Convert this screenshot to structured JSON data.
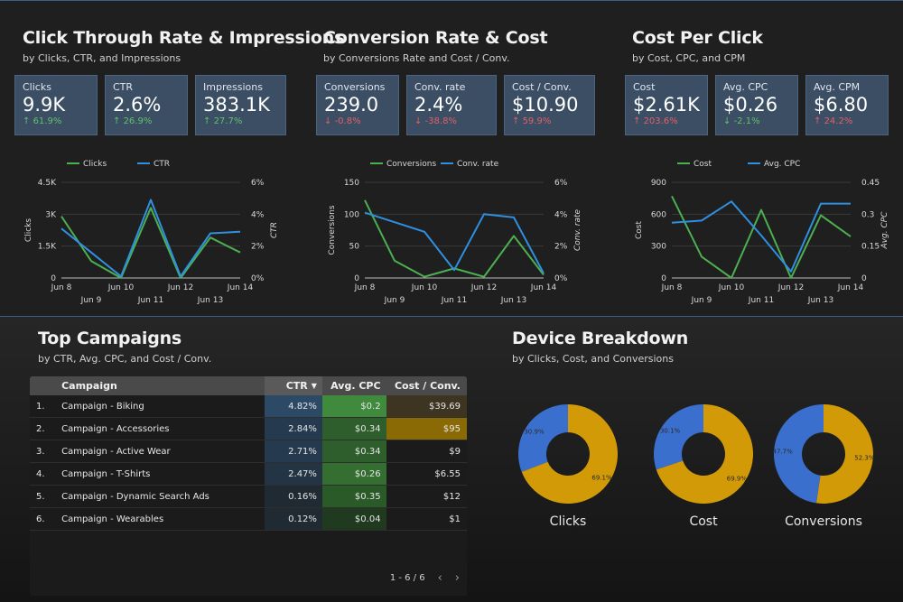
{
  "colors": {
    "green": "#4caf50",
    "blue": "#2f8fe0",
    "kpi_bg": "#3b4e63",
    "donut_blue": "#3b6fce",
    "donut_gold": "#d19a06"
  },
  "sections": [
    {
      "title": "Click Through Rate & Impressions",
      "subtitle": "by Clicks, CTR, and Impressions",
      "kpis": [
        {
          "label": "Clicks",
          "value": "9.9K",
          "delta": "61.9%",
          "dir": "up"
        },
        {
          "label": "CTR",
          "value": "2.6%",
          "delta": "26.9%",
          "dir": "up"
        },
        {
          "label": "Impressions",
          "value": "383.1K",
          "delta": "27.7%",
          "dir": "up"
        }
      ]
    },
    {
      "title": "Conversion Rate & Cost",
      "subtitle": "by Conversions Rate and Cost / Conv.",
      "kpis": [
        {
          "label": "Conversions",
          "value": "239.0",
          "delta": "-0.8%",
          "dir": "down"
        },
        {
          "label": "Conv. rate",
          "value": "2.4%",
          "delta": "-38.8%",
          "dir": "down"
        },
        {
          "label": "Cost / Conv.",
          "value": "$10.90",
          "delta": "59.9%",
          "dir": "up-bad"
        }
      ]
    },
    {
      "title": "Cost Per Click",
      "subtitle": "by Cost, CPC, and CPM",
      "kpis": [
        {
          "label": "Cost",
          "value": "$2.61K",
          "delta": "203.6%",
          "dir": "up-bad"
        },
        {
          "label": "Avg. CPC",
          "value": "$0.26",
          "delta": "-2.1%",
          "dir": "down-good"
        },
        {
          "label": "Avg. CPM",
          "value": "$6.80",
          "delta": "24.2%",
          "dir": "up-bad"
        }
      ]
    }
  ],
  "chart_data": [
    {
      "type": "line",
      "x": [
        "Jun 8",
        "Jun 9",
        "Jun 10",
        "Jun 11",
        "Jun 12",
        "Jun 13",
        "Jun 14"
      ],
      "series": [
        {
          "name": "Clicks",
          "axis": "left",
          "values": [
            2900,
            800,
            0,
            3300,
            0,
            1900,
            1200
          ]
        },
        {
          "name": "CTR",
          "axis": "right",
          "values": [
            3.1,
            1.6,
            0.1,
            4.9,
            0.1,
            2.8,
            2.9
          ]
        }
      ],
      "ylabel": "Clicks",
      "y2label": "CTR",
      "yticks": [
        "0",
        "1.5K",
        "3K",
        "4.5K"
      ],
      "ylim": [
        0,
        4500
      ],
      "y2ticks": [
        "0%",
        "2%",
        "4%",
        "6%"
      ],
      "y2lim": [
        0,
        6
      ]
    },
    {
      "type": "line",
      "x": [
        "Jun 8",
        "Jun 9",
        "Jun 10",
        "Jun 11",
        "Jun 12",
        "Jun 13",
        "Jun 14"
      ],
      "series": [
        {
          "name": "Conversions",
          "axis": "left",
          "values": [
            122,
            27,
            2,
            15,
            2,
            66,
            5
          ]
        },
        {
          "name": "Conv. rate",
          "axis": "right",
          "values": [
            4.1,
            3.5,
            2.9,
            0.5,
            4.0,
            3.8,
            0.3
          ]
        }
      ],
      "ylabel": "Conversions",
      "y2label": "Conv. rate",
      "yticks": [
        "0",
        "50",
        "100",
        "150"
      ],
      "ylim": [
        0,
        150
      ],
      "y2ticks": [
        "0%",
        "2%",
        "4%",
        "6%"
      ],
      "y2lim": [
        0,
        6
      ]
    },
    {
      "type": "line",
      "x": [
        "Jun 8",
        "Jun 9",
        "Jun 10",
        "Jun 11",
        "Jun 12",
        "Jun 13",
        "Jun 14"
      ],
      "series": [
        {
          "name": "Cost",
          "axis": "left",
          "values": [
            770,
            200,
            0,
            640,
            0,
            590,
            390
          ]
        },
        {
          "name": "Avg. CPC",
          "axis": "right",
          "values": [
            0.26,
            0.27,
            0.36,
            0.2,
            0.03,
            0.35,
            0.35
          ]
        }
      ],
      "ylabel": "Cost",
      "y2label": "Avg. CPC",
      "yticks": [
        "0",
        "300",
        "600",
        "900"
      ],
      "ylim": [
        0,
        900
      ],
      "y2ticks": [
        "0",
        "0.15",
        "0.3",
        "0.45"
      ],
      "y2lim": [
        0,
        0.45
      ]
    },
    {
      "type": "table",
      "title": "Top Campaigns",
      "subtitle": "by CTR, Avg. CPC, and Cost / Conv.",
      "columns": [
        "Campaign",
        "CTR",
        "Avg. CPC",
        "Cost / Conv."
      ],
      "rows": [
        {
          "num": "1.",
          "name": "Campaign - Biking",
          "ctr": "4.82%",
          "cpc": "$0.2",
          "cost": "$39.69"
        },
        {
          "num": "2.",
          "name": "Campaign - Accessories",
          "ctr": "2.84%",
          "cpc": "$0.34",
          "cost": "$95"
        },
        {
          "num": "3.",
          "name": "Campaign - Active Wear",
          "ctr": "2.71%",
          "cpc": "$0.34",
          "cost": "$9"
        },
        {
          "num": "4.",
          "name": "Campaign - T-Shirts",
          "ctr": "2.47%",
          "cpc": "$0.26",
          "cost": "$6.55"
        },
        {
          "num": "5.",
          "name": "Campaign - Dynamic Search Ads",
          "ctr": "0.16%",
          "cpc": "$0.35",
          "cost": "$12"
        },
        {
          "num": "6.",
          "name": "Campaign - Wearables",
          "ctr": "0.12%",
          "cpc": "$0.04",
          "cost": "$1"
        }
      ],
      "pagination": "1 - 6 / 6"
    },
    {
      "type": "pie",
      "title": "Device Breakdown",
      "subtitle": "by Clicks, Cost, and Conversions",
      "donuts": [
        {
          "label": "Clicks",
          "slices": [
            {
              "value": 30.9,
              "text": "30.9%"
            },
            {
              "value": 69.1,
              "text": "69.1%"
            }
          ]
        },
        {
          "label": "Cost",
          "slices": [
            {
              "value": 30.1,
              "text": "30.1%"
            },
            {
              "value": 69.9,
              "text": "69.9%"
            }
          ]
        },
        {
          "label": "Conversions",
          "slices": [
            {
              "value": 47.7,
              "text": "47.7%"
            },
            {
              "value": 52.3,
              "text": "52.3%"
            }
          ]
        }
      ]
    }
  ]
}
